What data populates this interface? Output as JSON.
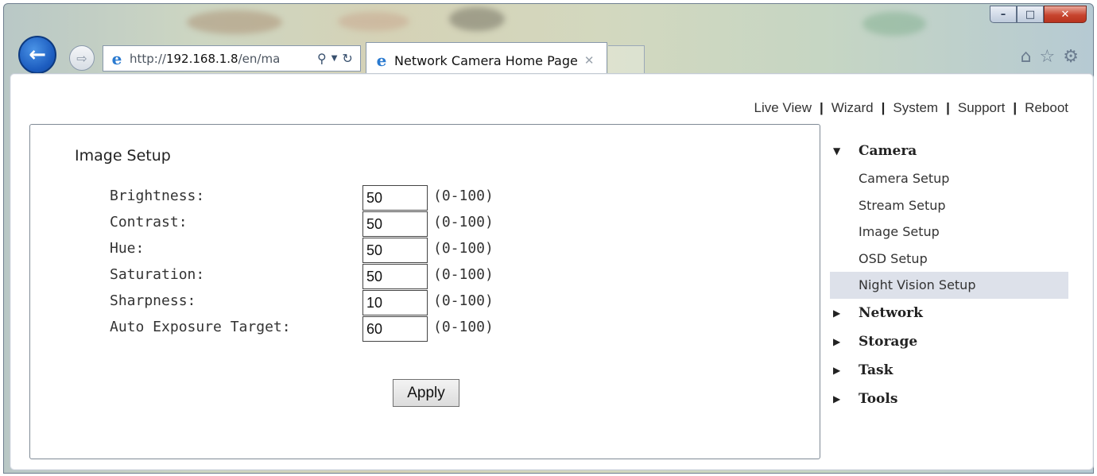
{
  "browser": {
    "address": {
      "scheme": "http://",
      "host": "192.168.1.8",
      "path": "/en/ma"
    },
    "tab": {
      "title": "Network Camera Home Page",
      "close_glyph": "✕"
    },
    "caption": {
      "minimize": "–",
      "maximize": "□",
      "close": "✕"
    },
    "icons": [
      "back-arrow-icon",
      "forward-arrow-icon",
      "ie-logo-icon",
      "search-icon",
      "dropdown-icon",
      "refresh-icon",
      "home-icon",
      "favorites-star-icon",
      "settings-gear-icon"
    ]
  },
  "topnav": {
    "items": [
      "Live View",
      "Wizard",
      "System",
      "Support",
      "Reboot"
    ],
    "separator": "|"
  },
  "panel": {
    "title": "Image Setup",
    "fields": [
      {
        "label": "Brightness:",
        "value": "50",
        "range": "(0-100)"
      },
      {
        "label": "Contrast:",
        "value": "50",
        "range": "(0-100)"
      },
      {
        "label": "Hue:",
        "value": "50",
        "range": "(0-100)"
      },
      {
        "label": "Saturation:",
        "value": "50",
        "range": "(0-100)"
      },
      {
        "label": "Sharpness:",
        "value": "10",
        "range": "(0-100)"
      },
      {
        "label": "Auto Exposure Target:",
        "value": "60",
        "range": "(0-100)"
      }
    ],
    "apply_label": "Apply"
  },
  "sidebar": {
    "camera": {
      "label": "Camera",
      "expanded": true,
      "items": [
        "Camera Setup",
        "Stream Setup",
        "Image Setup",
        "OSD Setup",
        "Night Vision Setup"
      ],
      "highlighted": "Night Vision Setup"
    },
    "sections": [
      "Network",
      "Storage",
      "Task",
      "Tools"
    ]
  }
}
